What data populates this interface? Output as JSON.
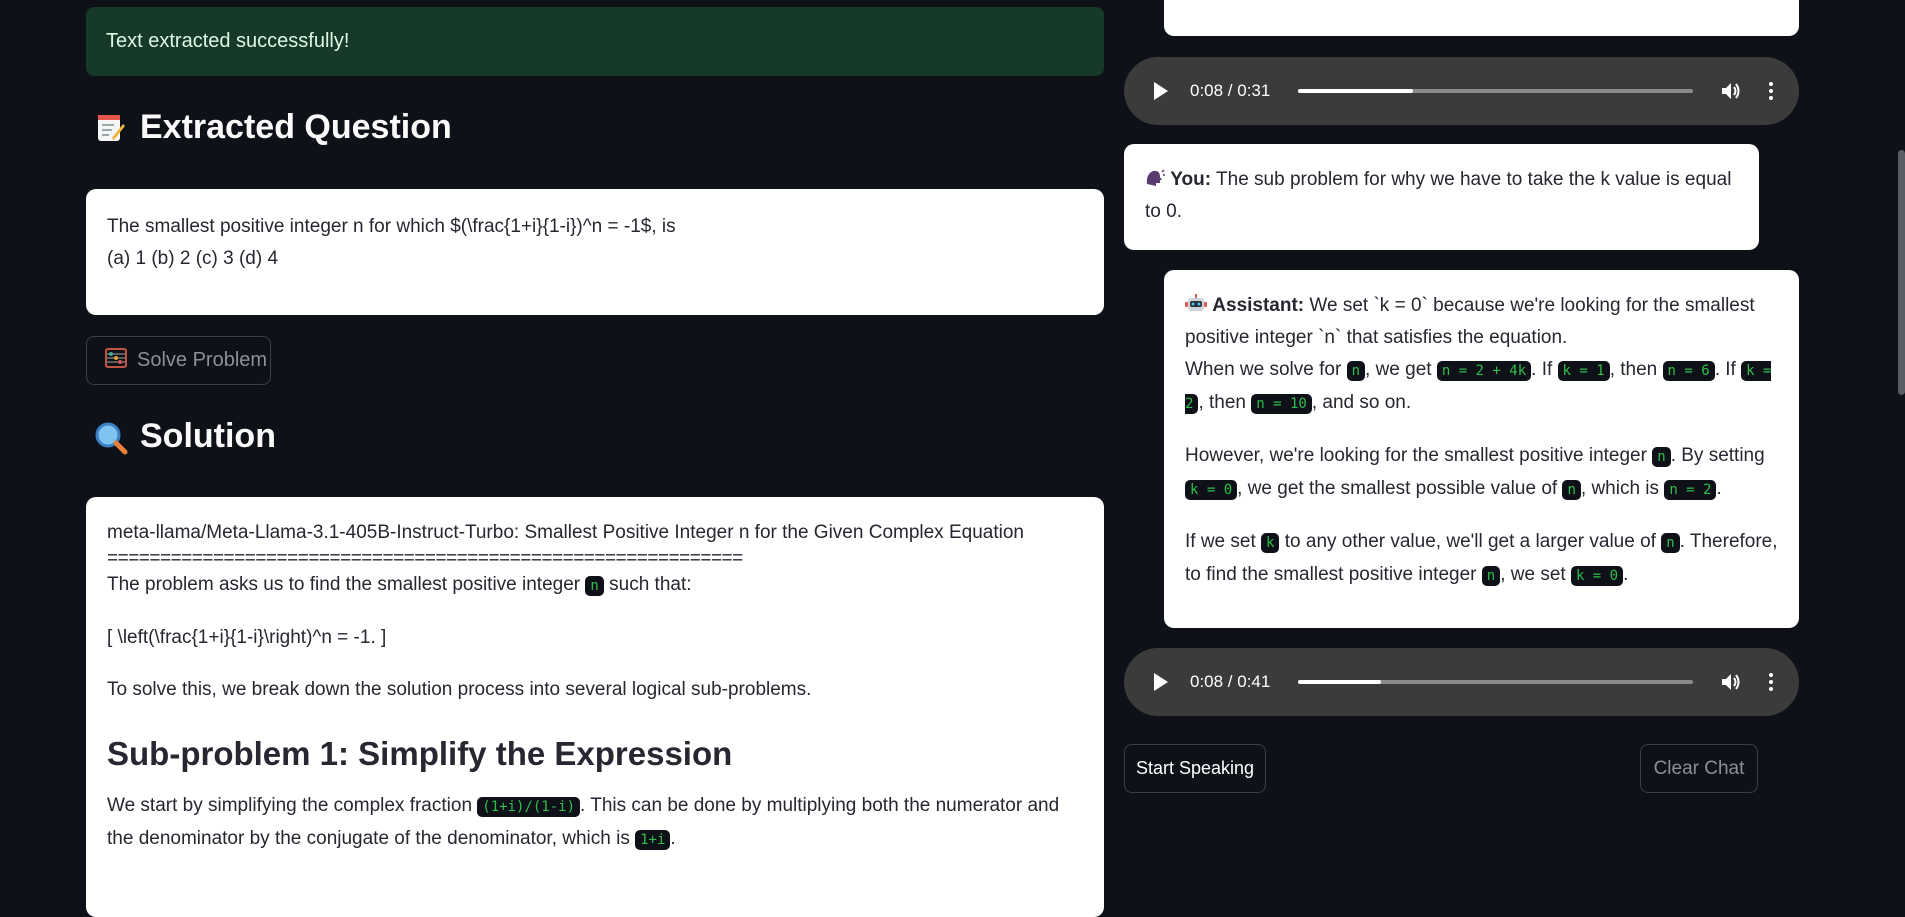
{
  "status": {
    "success_message": "Text extracted successfully!"
  },
  "extracted": {
    "heading": "Extracted Question",
    "line1": "The smallest positive integer n for which $(\\frac{1+i}{1-i})^n = -1$, is",
    "line2": "(a) 1 (b) 2 (c) 3 (d) 4"
  },
  "solve_button": {
    "label": "Solve Problem"
  },
  "solution": {
    "heading": "Solution",
    "model_line": "meta-llama/Meta-Llama-3.1-405B-Instruct-Turbo: Smallest Positive Integer n for the Given Complex Equation",
    "rule": "============================================================",
    "p1_before": "The problem asks us to find the smallest positive integer ",
    "p1_code": "n",
    "p1_after": " such that:",
    "p2": "[ \\left(\\frac{1+i}{1-i}\\right)^n = -1. ]",
    "p3": "To solve this, we break down the solution process into several logical sub-problems.",
    "sub1_title": "Sub-problem 1: Simplify the Expression",
    "p4_before": "We start by simplifying the complex fraction ",
    "p4_code": "(1+i)/(1-i)",
    "p4_mid": ". This can be done by multiplying both the numerator and the denominator by the conjugate of the denominator, which is ",
    "p4_code2": "1+i",
    "p4_after": "."
  },
  "audio1": {
    "time": "0:08 / 0:31",
    "progress": 0.29
  },
  "audio2": {
    "time": "0:08 / 0:41",
    "progress": 0.21
  },
  "you_msg": {
    "label": "You:",
    "text": " The sub problem for why we have to take the k value is equal to 0."
  },
  "assistant_msg": {
    "label": "Assistant:",
    "l1": " We set `k = 0` because we're looking for the smallest positive integer `n` that satisfies the equation.",
    "l2a": "When we solve for ",
    "c_n": "n",
    "l2b": ", we get ",
    "c_n2p4k": "n = 2 + 4k",
    "l2c": ". If ",
    "c_k1": "k = 1",
    "l2d": ", then ",
    "c_n6": "n = 6",
    "l2e": ". If ",
    "c_k2": "k = 2",
    "l2f": ", then ",
    "c_n10": "n = 10",
    "l2g": ", and so on.",
    "p2a": "However, we're looking for the smallest positive integer ",
    "p2b": ". By setting ",
    "c_k0": "k = 0",
    "p2c": ", we get the smallest possible value of ",
    "p2d": ", which is ",
    "c_n2": "n = 2",
    "p2e": ".",
    "p3a": "If we set ",
    "c_k": "k",
    "p3b": " to any other value, we'll get a larger value of ",
    "p3c": ". Therefore, to find the smallest positive integer ",
    "p3d": ", we set ",
    "p3e": "."
  },
  "buttons": {
    "start_speaking": "Start Speaking",
    "clear_chat": "Clear Chat"
  },
  "icons": {
    "memo": "memo-icon",
    "magnifier": "magnifying-glass-icon",
    "abacus": "abacus-icon",
    "speaking_head": "speaking-head-icon",
    "robot": "robot-icon",
    "play": "play-icon",
    "volume": "volume-icon",
    "more": "more-vertical-icon"
  }
}
